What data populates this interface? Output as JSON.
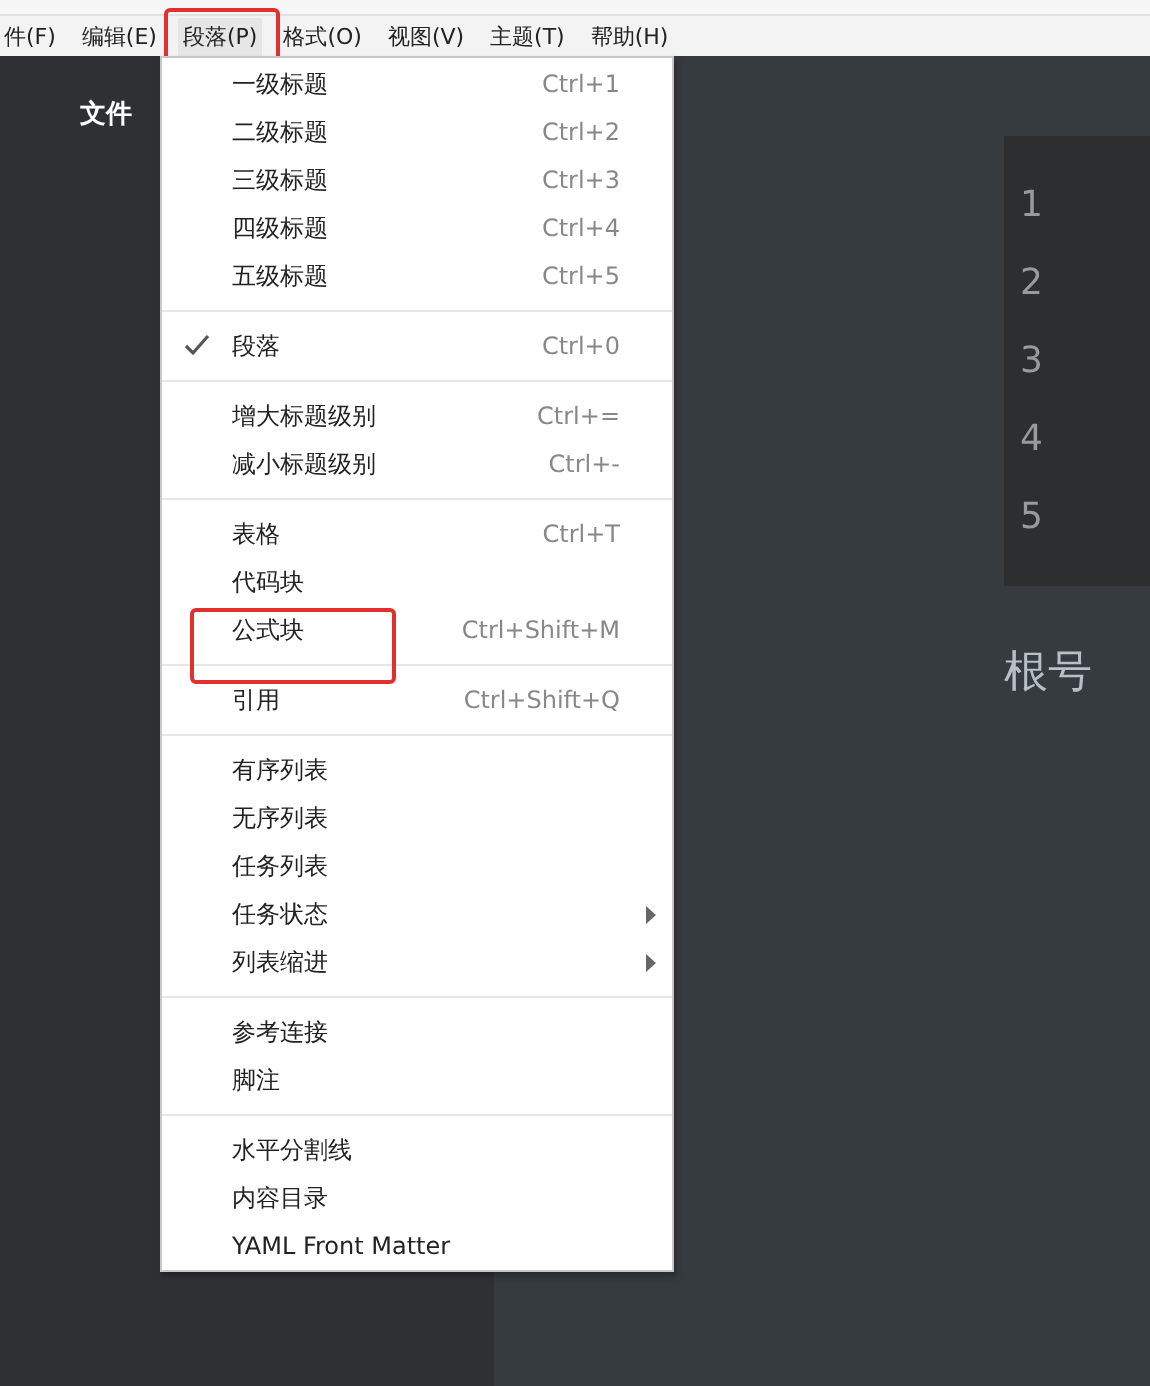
{
  "menu_bar": [
    {
      "label": "件(F)",
      "selected": false,
      "highlighted": false
    },
    {
      "label": "编辑(E)",
      "selected": false,
      "highlighted": false
    },
    {
      "label": "段落(P)",
      "selected": true,
      "highlighted": true
    },
    {
      "label": "格式(O)",
      "selected": false,
      "highlighted": false
    },
    {
      "label": "视图(V)",
      "selected": false,
      "highlighted": false
    },
    {
      "label": "主题(T)",
      "selected": false,
      "highlighted": false
    },
    {
      "label": "帮助(H)",
      "selected": false,
      "highlighted": false
    }
  ],
  "sidebar": {
    "title": "文件"
  },
  "dropdown_menu": {
    "groups": [
      [
        {
          "label": "一级标题",
          "shortcut": "Ctrl+1",
          "checked": false,
          "submenu": false,
          "highlighted": false
        },
        {
          "label": "二级标题",
          "shortcut": "Ctrl+2",
          "checked": false,
          "submenu": false,
          "highlighted": false
        },
        {
          "label": "三级标题",
          "shortcut": "Ctrl+3",
          "checked": false,
          "submenu": false,
          "highlighted": false
        },
        {
          "label": "四级标题",
          "shortcut": "Ctrl+4",
          "checked": false,
          "submenu": false,
          "highlighted": false
        },
        {
          "label": "五级标题",
          "shortcut": "Ctrl+5",
          "checked": false,
          "submenu": false,
          "highlighted": false
        }
      ],
      [
        {
          "label": "段落",
          "shortcut": "Ctrl+0",
          "checked": true,
          "submenu": false,
          "highlighted": false
        }
      ],
      [
        {
          "label": "增大标题级别",
          "shortcut": "Ctrl+=",
          "checked": false,
          "submenu": false,
          "highlighted": false
        },
        {
          "label": "减小标题级别",
          "shortcut": "Ctrl+-",
          "checked": false,
          "submenu": false,
          "highlighted": false
        }
      ],
      [
        {
          "label": "表格",
          "shortcut": "Ctrl+T",
          "checked": false,
          "submenu": false,
          "highlighted": false
        },
        {
          "label": "代码块",
          "checked": false,
          "submenu": false,
          "highlighted": false
        },
        {
          "label": "公式块",
          "shortcut": "Ctrl+Shift+M",
          "checked": false,
          "submenu": false,
          "highlighted": true
        }
      ],
      [
        {
          "label": "引用",
          "shortcut": "Ctrl+Shift+Q",
          "checked": false,
          "submenu": false,
          "highlighted": false
        }
      ],
      [
        {
          "label": "有序列表",
          "checked": false,
          "submenu": false,
          "highlighted": false
        },
        {
          "label": "无序列表",
          "checked": false,
          "submenu": false,
          "highlighted": false
        },
        {
          "label": "任务列表",
          "checked": false,
          "submenu": false,
          "highlighted": false
        },
        {
          "label": "任务状态",
          "checked": false,
          "submenu": true,
          "highlighted": false
        },
        {
          "label": "列表缩进",
          "checked": false,
          "submenu": true,
          "highlighted": false
        }
      ],
      [
        {
          "label": "参考连接",
          "checked": false,
          "submenu": false,
          "highlighted": false
        },
        {
          "label": "脚注",
          "checked": false,
          "submenu": false,
          "highlighted": false
        }
      ],
      [
        {
          "label": "水平分割线",
          "checked": false,
          "submenu": false,
          "highlighted": false
        },
        {
          "label": "内容目录",
          "checked": false,
          "submenu": false,
          "highlighted": false
        },
        {
          "label": "YAML Front Matter",
          "checked": false,
          "submenu": false,
          "highlighted": false
        }
      ]
    ]
  },
  "editor": {
    "code_block": {
      "line_numbers": [
        "1",
        "2",
        "3",
        "4",
        "5"
      ]
    },
    "text": "根号"
  }
}
